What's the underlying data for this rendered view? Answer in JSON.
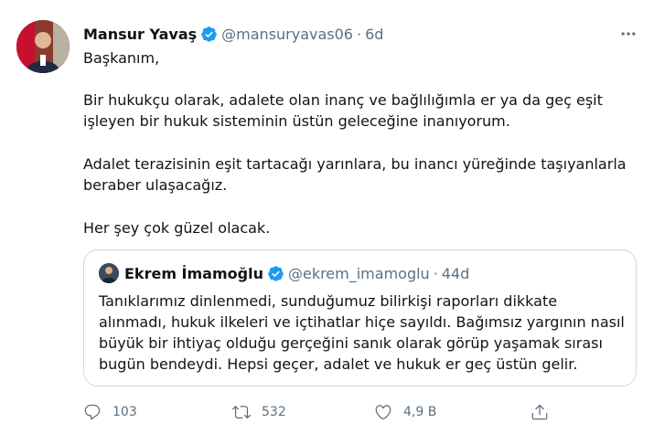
{
  "tweet": {
    "author_name": "Mansur Yavaş",
    "author_handle": "@mansuryavas06",
    "separator": "·",
    "time": "6d",
    "paragraphs": [
      "Başkanım,",
      "Bir hukukçu olarak, adalete olan inanç ve bağlılığımla er ya da geç eşit işleyen bir hukuk sisteminin üstün geleceğine inanıyorum.",
      "Adalet terazisinin eşit tartacağı yarınlara, bu inancı yüreğinde taşıyanlarla beraber ulaşacağız.",
      "Her şey çok güzel olacak."
    ],
    "icon_more": "more-icon"
  },
  "quoted": {
    "author_name": "Ekrem İmamoğlu",
    "author_handle": "@ekrem_imamoglu",
    "separator": "·",
    "time": "44d",
    "text": "Tanıklarımız dinlenmedi, sunduğumuz bilirkişi raporları dikkate alınmadı, hukuk ilkeleri ve içtihatlar hiçe sayıldı. Bağımsız yargının nasıl büyük bir ihtiyaç olduğu gerçeğini sanık olarak görüp yaşamak sırası bugün bendeydi. Hepsi geçer, adalet ve hukuk er geç üstün gelir."
  },
  "actions": {
    "reply_count": "103",
    "retweet_count": "532",
    "like_count": "4,9 B"
  },
  "colors": {
    "verified": "#1d9bf0",
    "secondary_text": "#5b7083",
    "border": "#cfd9de"
  }
}
